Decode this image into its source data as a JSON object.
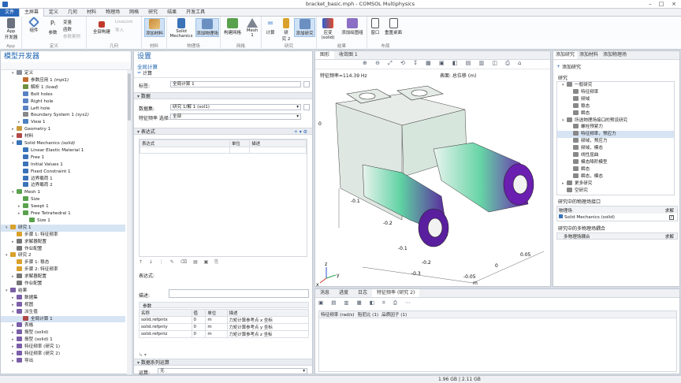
{
  "window": {
    "title": "bracket_basic.mph - COMSOL Multiphysics"
  },
  "ribbon_tabs": [
    "文件",
    "主屏幕",
    "定义",
    "几何",
    "材料",
    "物理场",
    "网格",
    "研究",
    "结果",
    "开发工具"
  ],
  "ribbon": {
    "app_builder": [
      "App",
      "开发器"
    ],
    "app_group": "App",
    "component": "组件",
    "add_component": "添加组件",
    "params": "参数",
    "var": "变量",
    "func": "函数",
    "param_cases": "参数案例",
    "define_group": "定义",
    "build_all": "全部构建",
    "livelink": "LiveLink",
    "import": "导入",
    "geom_group": "几何",
    "add_material": "添加材料",
    "materials_group": "材料",
    "solid_mech": [
      "Solid",
      "Mechanics"
    ],
    "add_physics": "添加物理场",
    "physics_group": "物理场",
    "build_mesh": "构建网格",
    "mesh1": [
      "Mesh",
      "1"
    ],
    "mesh_group": "网格",
    "compute": "计算",
    "study2": [
      "研",
      "究 2"
    ],
    "add_study": "添加研究",
    "study_group": "研究",
    "plot_solid": [
      "应变",
      "(solid)"
    ],
    "add_plot": "添加绘图组",
    "results_group": "结果",
    "windows": "窗口",
    "reset_desktop": "重置桌面",
    "layout_group": "布局"
  },
  "model_builder": {
    "title": "模型开发器",
    "tree": [
      {
        "label": "定义",
        "depth": 1,
        "exp": "▾",
        "c": "#8a8f99"
      },
      {
        "label": "参数应用 1",
        "tag": "(mpl1)",
        "depth": 2,
        "c": "#c26a2d"
      },
      {
        "label": "解析 1",
        "tag": "(load)",
        "depth": 2,
        "c": "#6f8f3d"
      },
      {
        "label": "Bolt holes",
        "depth": 2,
        "c": "#5a83c4"
      },
      {
        "label": "Right hole",
        "depth": 2,
        "c": "#5a83c4"
      },
      {
        "label": "Left hole",
        "depth": 2,
        "c": "#5a83c4"
      },
      {
        "label": "Boundary System 1",
        "tag": "(sys1)",
        "depth": 2,
        "c": "#888"
      },
      {
        "label": "View 1",
        "depth": 2,
        "exp": "▸",
        "c": "#4a7fc1"
      },
      {
        "label": "Geometry 1",
        "depth": 1,
        "exp": "▸",
        "c": "#c79a3a"
      },
      {
        "label": "材料",
        "depth": 1,
        "exp": "▸",
        "c": "#b04747"
      },
      {
        "label": "Solid Mechanics",
        "tag": "(solid)",
        "depth": 1,
        "exp": "▾",
        "c": "#3a73b8"
      },
      {
        "label": "Linear Elastic Material 1",
        "depth": 2,
        "c": "#3a73b8"
      },
      {
        "label": "Free 1",
        "depth": 2,
        "c": "#3a73b8"
      },
      {
        "label": "Initial Values 1",
        "depth": 2,
        "c": "#3a73b8"
      },
      {
        "label": "Fixed Constraint 1",
        "depth": 2,
        "c": "#3a73b8"
      },
      {
        "label": "边界载荷 1",
        "depth": 2,
        "c": "#3a73b8"
      },
      {
        "label": "边界载荷 2",
        "depth": 2,
        "c": "#3a73b8"
      },
      {
        "label": "Mesh 1",
        "depth": 1,
        "exp": "▾",
        "c": "#5aa14e"
      },
      {
        "label": "Size",
        "depth": 2,
        "c": "#5aa14e"
      },
      {
        "label": "Swept 1",
        "depth": 2,
        "exp": "▸",
        "c": "#5aa14e"
      },
      {
        "label": "Free Tetrahedral 1",
        "depth": 2,
        "exp": "▸",
        "c": "#5aa14e"
      },
      {
        "label": "Size 1",
        "depth": 3,
        "c": "#5aa14e"
      },
      {
        "label": "研究 1",
        "depth": 0,
        "exp": "▾",
        "c": "#d9a02b",
        "sel": true
      },
      {
        "label": "步骤 1: 特征频率",
        "depth": 1,
        "c": "#d9a02b"
      },
      {
        "label": "求解器配置",
        "depth": 1,
        "exp": "▸",
        "c": "#777"
      },
      {
        "label": "作业配置",
        "depth": 1,
        "c": "#777"
      },
      {
        "label": "研究 2",
        "depth": 0,
        "exp": "▾",
        "c": "#d9a02b"
      },
      {
        "label": "步骤 1: 稳态",
        "depth": 1,
        "c": "#d9a02b"
      },
      {
        "label": "步骤 2: 特征频率",
        "depth": 1,
        "c": "#d9a02b"
      },
      {
        "label": "求解器配置",
        "depth": 1,
        "exp": "▸",
        "c": "#777"
      },
      {
        "label": "作业配置",
        "depth": 1,
        "c": "#777"
      },
      {
        "label": "结果",
        "depth": 0,
        "exp": "▾",
        "c": "#7a5ea8"
      },
      {
        "label": "数据集",
        "depth": 1,
        "exp": "▸",
        "c": "#7a5ea8"
      },
      {
        "label": "视图",
        "depth": 1,
        "exp": "▸",
        "c": "#7a5ea8"
      },
      {
        "label": "派生值",
        "depth": 1,
        "exp": "▾",
        "c": "#7a5ea8"
      },
      {
        "label": "全局计算 1",
        "depth": 2,
        "c": "#b04747",
        "sel": true
      },
      {
        "label": "表格",
        "depth": 1,
        "exp": "▸",
        "c": "#7a5ea8"
      },
      {
        "label": "振型 (solid)",
        "depth": 1,
        "exp": "▸",
        "c": "#7a5ea8"
      },
      {
        "label": "振型 (solid) 1",
        "depth": 1,
        "exp": "▸",
        "c": "#7a5ea8"
      },
      {
        "label": "特征频率 (研究 1)",
        "depth": 1,
        "exp": "▸",
        "c": "#7a5ea8"
      },
      {
        "label": "特征频率 (研究 2)",
        "depth": 1,
        "exp": "▸",
        "c": "#7a5ea8"
      },
      {
        "label": "导出",
        "depth": 1,
        "exp": "▸",
        "c": "#7a5ea8"
      }
    ]
  },
  "settings": {
    "title": "设置",
    "subtitle": "全局计算",
    "compute": "计算",
    "label_key": "标签:",
    "label_value": "全局计算 1",
    "data_section": "数据",
    "dataset_key": "数据集:",
    "dataset_value": "研究 1/解 1 (sol1)",
    "eigen_key": "特征频率 选择:",
    "eigen_value": "全部",
    "expr_section": "表达式",
    "expr_headers": [
      "表达式",
      "单位",
      "描述"
    ],
    "expr_label": "表达式:",
    "desc_label": "描述:",
    "params_section": "参数",
    "param_headers": [
      "名称",
      "值",
      "单位",
      "描述"
    ],
    "param_rows": [
      [
        "solid.refpntx",
        "0",
        "m",
        "力矩计算参考点 x 坐标"
      ],
      [
        "solid.refpnty",
        "0",
        "m",
        "力矩计算参考点 y 坐标"
      ],
      [
        "solid.refpntz",
        "0",
        "m",
        "力矩计算参考点 z 坐标"
      ]
    ],
    "series_section": "数据系列运算",
    "op_key": "运算:",
    "op_value": "无"
  },
  "graphics": {
    "tabs": [
      "图形",
      "收敛图 1"
    ],
    "eigen_label": "特征频率=114.39 Hz",
    "surface_label": "表面: 总位移 (m)",
    "axis_ticks": [
      "0",
      "-0.1",
      "-0.2",
      "-0.1",
      "-0.2",
      "-0.3",
      "-0.05",
      "0",
      "0.05",
      "m"
    ],
    "axes": [
      "z",
      "y",
      "x"
    ]
  },
  "bottom": {
    "tabs": [
      "消息",
      "进度",
      "日志",
      "特征频率 (研究 2)"
    ],
    "headers": [
      "特征频率 (rad/s)",
      "阻尼比 (1)",
      "品质因子 (1)"
    ]
  },
  "add_study": {
    "tabs": [
      "添加研究",
      "添加材料",
      "添加物理场"
    ],
    "add_label": "添加研究",
    "section": "研究",
    "tree": [
      {
        "label": "一般研究",
        "depth": 0,
        "exp": "▾"
      },
      {
        "label": "特征频率",
        "depth": 1
      },
      {
        "label": "频域",
        "depth": 1
      },
      {
        "label": "稳态",
        "depth": 1
      },
      {
        "label": "瞬态",
        "depth": 1
      },
      {
        "label": "所选物理场接口的预设研究",
        "depth": 0,
        "exp": "▾"
      },
      {
        "label": "螺栓预紧力",
        "depth": 1
      },
      {
        "label": "特征频率，预应力",
        "depth": 1,
        "sel": true
      },
      {
        "label": "频域，预应力",
        "depth": 1
      },
      {
        "label": "频域，模态",
        "depth": 1
      },
      {
        "label": "线性屈曲",
        "depth": 1
      },
      {
        "label": "模态降阶模型",
        "depth": 1
      },
      {
        "label": "瞬态",
        "depth": 1
      },
      {
        "label": "瞬态，模态",
        "depth": 1
      },
      {
        "label": "更多研究",
        "depth": 0,
        "exp": "▸"
      },
      {
        "label": "空研究",
        "depth": 0
      }
    ],
    "interface_section": "研究中的物理场接口",
    "phys_header": "物理场",
    "solve_header": "求解",
    "phys_row": "Solid Mechanics (solid)",
    "multi_section": "研究中的多物理场耦合",
    "multi_header": "多物理场耦合",
    "multi_solve": "求解"
  },
  "status": {
    "memory": "1.96 GB | 2.11 GB"
  }
}
